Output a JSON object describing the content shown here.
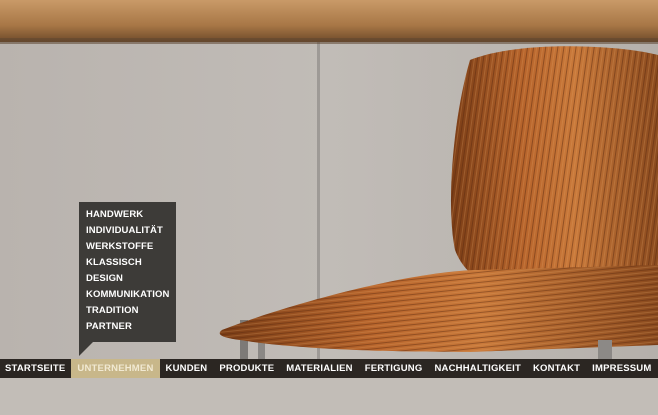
{
  "hero": {
    "image_name": "wooden-chair-photo",
    "colors": {
      "wall": "#bcb7b2",
      "wood": "#a45c2a",
      "top_beam": "#b98a5c"
    }
  },
  "submenu": {
    "items": [
      {
        "label": "HANDWERK"
      },
      {
        "label": "INDIVIDUALITÄT"
      },
      {
        "label": "WERKSTOFFE"
      },
      {
        "label": "KLASSISCH"
      },
      {
        "label": "DESIGN"
      },
      {
        "label": "KOMMUNIKATION"
      },
      {
        "label": "TRADITION"
      },
      {
        "label": "PARTNER"
      }
    ]
  },
  "nav": {
    "active": "UNTERNEHMEN",
    "items": [
      {
        "label": "STARTSEITE"
      },
      {
        "label": "UNTERNEHMEN"
      },
      {
        "label": "KUNDEN"
      },
      {
        "label": "PRODUKTE"
      },
      {
        "label": "MATERIALIEN"
      },
      {
        "label": "FERTIGUNG"
      },
      {
        "label": "NACHHALTIGKEIT"
      },
      {
        "label": "KONTAKT"
      },
      {
        "label": "IMPRESSUM"
      }
    ],
    "colors": {
      "bar": "#2b2622",
      "active_bg": "#c8b78a",
      "text": "#ffffff"
    }
  }
}
